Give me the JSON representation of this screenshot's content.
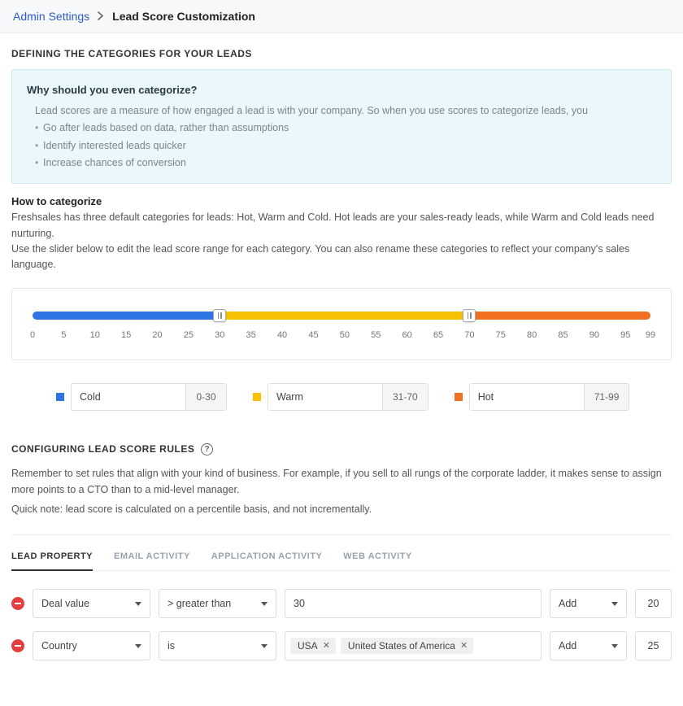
{
  "breadcrumb": {
    "root": "Admin Settings",
    "current": "Lead Score Customization"
  },
  "section1": {
    "title": "DEFINING THE CATEGORIES FOR YOUR LEADS",
    "info": {
      "question": "Why should you even categorize?",
      "intro": "Lead scores are a measure of how engaged a lead is with your company. So when you use scores to categorize leads, you",
      "bullets": [
        "Go after leads based on data, rather than assumptions",
        "Identify interested leads quicker",
        "Increase chances of conversion"
      ]
    },
    "howto": {
      "heading": "How to categorize",
      "line1": "Freshsales has three default categories for leads: Hot, Warm and Cold. Hot leads are your sales-ready leads, while Warm and Cold leads need nurturing.",
      "line2": "Use the slider below to edit the lead score range for each category. You can also rename these categories to reflect your company's sales language."
    }
  },
  "slider": {
    "min": 0,
    "max": 99,
    "break1": 30,
    "break2": 70,
    "ticks": [
      0,
      5,
      10,
      15,
      20,
      25,
      30,
      35,
      40,
      45,
      50,
      55,
      60,
      65,
      70,
      75,
      80,
      85,
      90,
      95,
      99
    ],
    "categories": {
      "cold": {
        "name": "Cold",
        "range": "0-30"
      },
      "warm": {
        "name": "Warm",
        "range": "31-70"
      },
      "hot": {
        "name": "Hot",
        "range": "71-99"
      }
    }
  },
  "section2": {
    "title": "CONFIGURING LEAD SCORE RULES",
    "desc": "Remember to set rules that align with your kind of business. For example, if you sell to all rungs of the corporate ladder, it makes sense to assign more points to a CTO than to a mid-level manager.",
    "note": "Quick note: lead score is calculated on a percentile basis, and not incrementally."
  },
  "tabs": [
    "LEAD  PROPERTY",
    "EMAIL  ACTIVITY",
    "APPLICATION  ACTIVITY",
    "WEB  ACTIVITY"
  ],
  "active_tab": 0,
  "rules": [
    {
      "property": "Deal value",
      "operator": "> greater than",
      "value": "30",
      "chips": [],
      "action": "Add",
      "points": "20"
    },
    {
      "property": "Country",
      "operator": "is",
      "value": "",
      "chips": [
        "USA",
        "United States of America"
      ],
      "action": "Add",
      "points": "25"
    }
  ]
}
